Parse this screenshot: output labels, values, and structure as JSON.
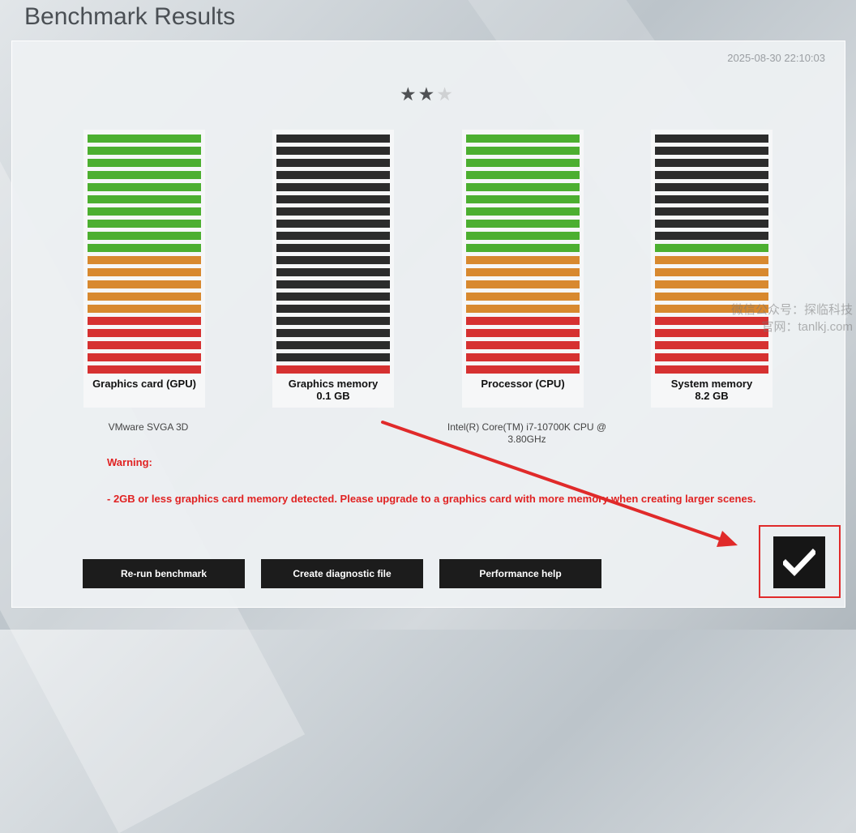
{
  "title": "Benchmark Results",
  "timestamp": "2025-08-30 22:10:03",
  "rating": {
    "value": 2,
    "max": 3
  },
  "meters": [
    {
      "label": "Graphics card (GPU)",
      "sub": "",
      "device": "VMware SVGA 3D",
      "level": 1.0
    },
    {
      "label": "Graphics memory",
      "sub": "0.1 GB",
      "device": "",
      "level": 0.05
    },
    {
      "label": "Processor (CPU)",
      "sub": "",
      "device": "Intel(R) Core(TM) i7-10700K CPU @ 3.80GHz",
      "level": 1.0
    },
    {
      "label": "System memory",
      "sub": "8.2 GB",
      "device": "",
      "level": 0.55
    }
  ],
  "warning": {
    "title": "Warning:",
    "text": "- 2GB or less graphics card memory detected. Please upgrade to a graphics card with more memory when creating larger scenes."
  },
  "buttons": {
    "rerun": "Re-run benchmark",
    "diagnostic": "Create diagnostic file",
    "help": "Performance help"
  },
  "watermark": {
    "line1": "微信公众号：探临科技",
    "line2": "官网：tanlkj.com"
  },
  "colors": {
    "green": "#4caf30",
    "orange": "#d8892f",
    "red": "#d63131",
    "inactive": "#2c2c2c",
    "annotation": "#e02a2a"
  }
}
